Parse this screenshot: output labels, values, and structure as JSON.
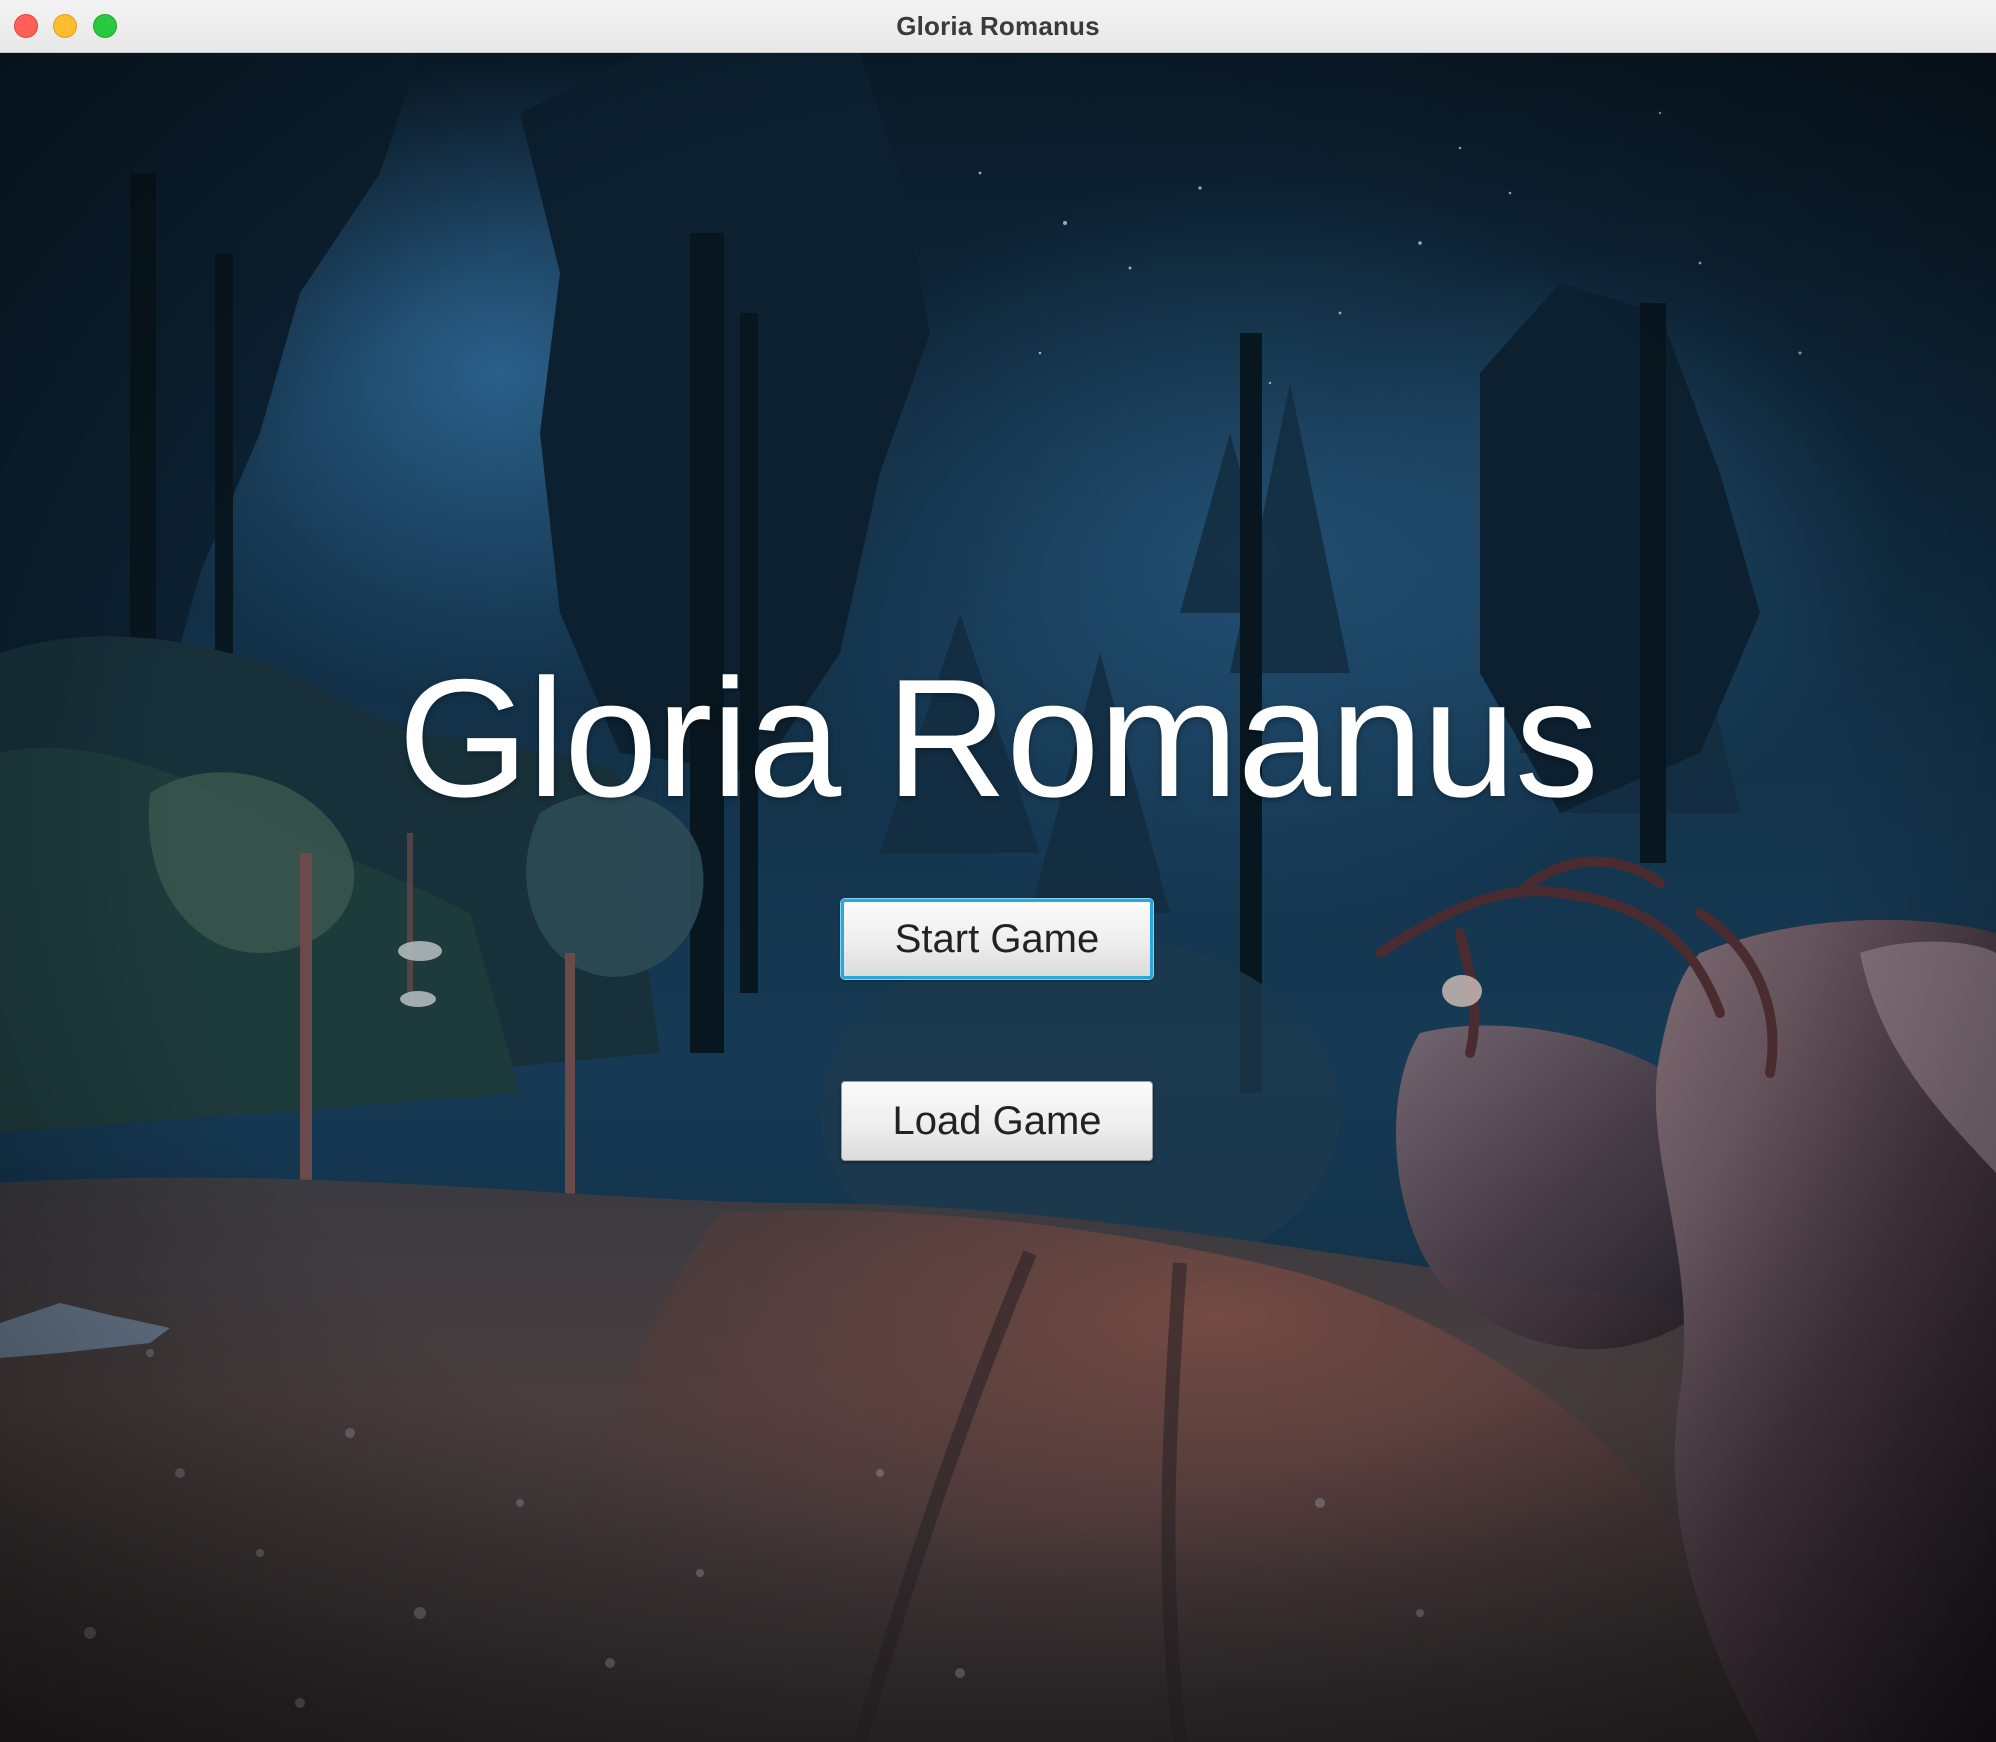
{
  "window": {
    "title": "Gloria Romanus",
    "controls": [
      "close",
      "minimize",
      "zoom"
    ]
  },
  "menu": {
    "game_title": "Gloria Romanus",
    "start_label": "Start Game",
    "load_label": "Load Game",
    "focused": "Start Game"
  },
  "background": {
    "description_icon": "night-forest-path-image"
  },
  "colors": {
    "focus_ring": "#2aa7dd",
    "title_text": "#ffffff",
    "sky": "#0e2a3f"
  }
}
